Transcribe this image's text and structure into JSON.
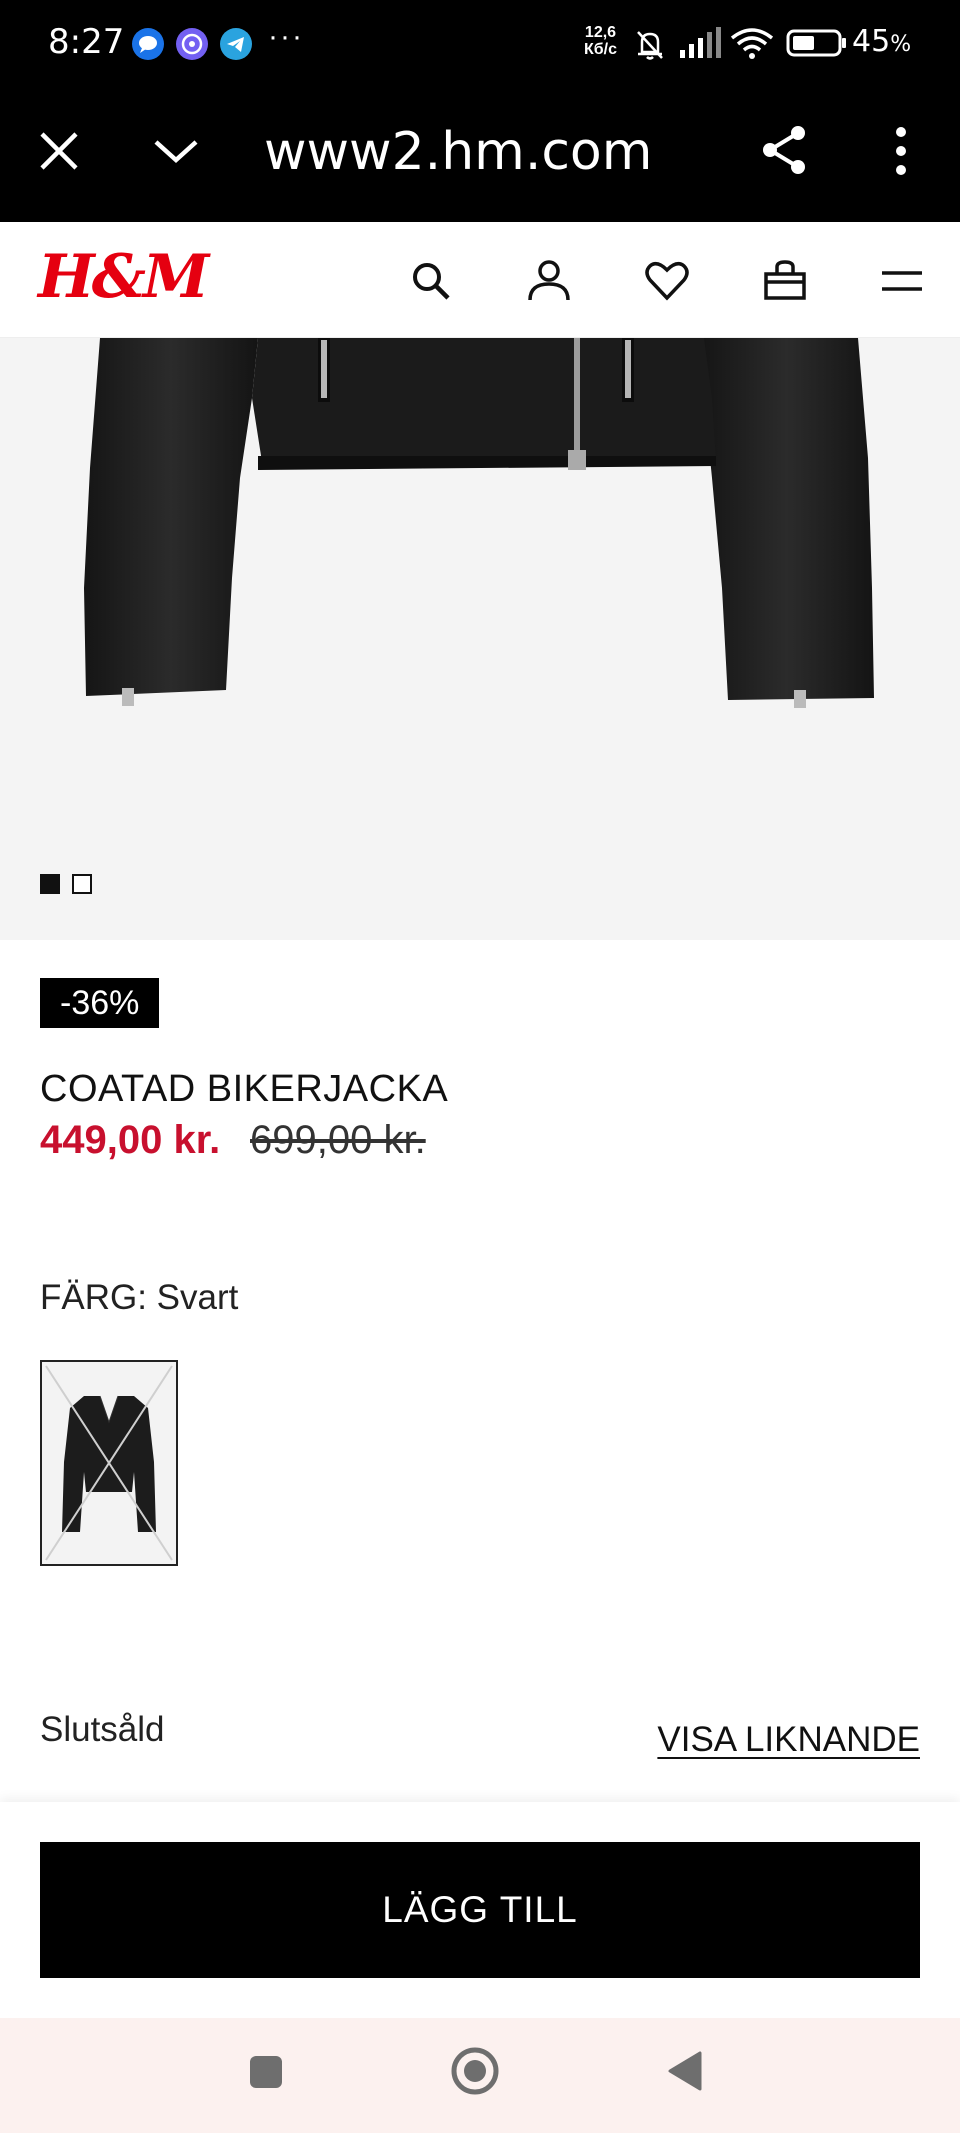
{
  "status_bar": {
    "time": "8:27",
    "apps": [
      "messages-icon",
      "viber-icon",
      "telegram-icon"
    ],
    "more": "···",
    "net_speed_value": "12,6",
    "net_speed_unit": "Кб/с",
    "battery_percent": "45",
    "battery_unit": "%"
  },
  "browser": {
    "url": "www2.hm.com",
    "icons": [
      "close-icon",
      "chevron-down-icon",
      "share-icon",
      "more-vertical-icon"
    ]
  },
  "header": {
    "logo": "H&M",
    "icons": [
      "search-icon",
      "account-icon",
      "favorites-icon",
      "bag-icon",
      "menu-icon"
    ]
  },
  "gallery": {
    "image_count": 2,
    "active_index": 0
  },
  "product": {
    "discount_badge": "-36%",
    "name": "COATAD BIKERJACKA",
    "price_sale": "449,00 kr.",
    "price_original": "699,00 kr.",
    "color_label": "FÄRG: Svart",
    "availability": "Slutsåld",
    "similar_link": "VISA LIKNANDE"
  },
  "actions": {
    "add_to_cart": "LÄGG TILL"
  },
  "colors": {
    "brand_red": "#e50010",
    "price_red": "#c8102e",
    "black": "#000000",
    "image_bg": "#f4f4f4",
    "nav_bg": "#fcf1ef"
  }
}
